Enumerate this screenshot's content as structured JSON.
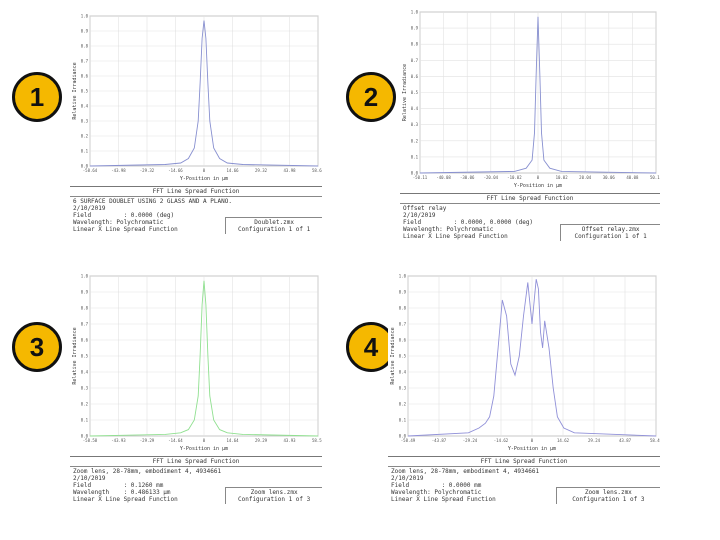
{
  "badges": [
    "1",
    "2",
    "3",
    "4"
  ],
  "chart_data": [
    {
      "type": "line",
      "title": "FFT Line Spread Function",
      "xlabel": "Y-Position in μm",
      "ylabel": "Relative Irradiance",
      "y_ticks": [
        "1.0",
        "0.9",
        "0.8",
        "0.7",
        "0.6",
        "0.5",
        "0.4",
        "0.3",
        "0.2",
        "0.1",
        "0.0"
      ],
      "x_ticks": [
        "-58.64",
        "-43.98",
        "-29.32",
        "-14.66",
        "0",
        "14.66",
        "29.32",
        "43.98",
        "58.64"
      ],
      "ylim": [
        0,
        1
      ],
      "series": [
        {
          "color": "#8890d0",
          "x": [
            -58.64,
            -20,
            -12,
            -8,
            -5,
            -3,
            -2,
            -1,
            0,
            1,
            2,
            3,
            5,
            8,
            12,
            20,
            58.64
          ],
          "y": [
            0,
            0.01,
            0.02,
            0.05,
            0.12,
            0.3,
            0.55,
            0.85,
            0.97,
            0.85,
            0.55,
            0.3,
            0.12,
            0.05,
            0.02,
            0.01,
            0
          ]
        }
      ],
      "footer": {
        "title": "FFT Line Spread Function",
        "lines": [
          "6 SURFACE DOUBLET USING 2 GLASS AND A PLANO.",
          "2/10/2019",
          "Field         : 0.0000 (deg)",
          "Wavelength: Polychromatic",
          "Linear X Line Spread Function"
        ],
        "file": [
          "Doublet.zmx",
          "Configuration 1 of 1"
        ]
      }
    },
    {
      "type": "line",
      "title": "FFT Line Spread Function",
      "xlabel": "Y-Position in μm",
      "ylabel": "Relative Irradiance",
      "y_ticks": [
        "1.0",
        "0.9",
        "0.8",
        "0.7",
        "0.6",
        "0.5",
        "0.4",
        "0.3",
        "0.2",
        "0.1",
        "0.0"
      ],
      "x_ticks": [
        "-50.11",
        "-40.08",
        "-30.06",
        "-20.04",
        "-10.02",
        "0",
        "10.02",
        "20.04",
        "30.06",
        "40.08",
        "50.11"
      ],
      "ylim": [
        0,
        1
      ],
      "series": [
        {
          "color": "#8890d0",
          "x": [
            -50.11,
            -10,
            -5,
            -2.5,
            -1.5,
            -0.8,
            0,
            0.8,
            1.5,
            2.5,
            5,
            10,
            50.11
          ],
          "y": [
            0,
            0.01,
            0.03,
            0.08,
            0.25,
            0.6,
            0.97,
            0.6,
            0.25,
            0.08,
            0.03,
            0.01,
            0
          ]
        }
      ],
      "footer": {
        "title": "FFT Line Spread Function",
        "lines": [
          "Offset relay",
          "2/10/2019",
          "Field         : 0.0000, 0.0000 (deg)",
          "Wavelength: Polychromatic",
          "Linear X Line Spread Function"
        ],
        "file": [
          "Offset relay.zmx",
          "Configuration 1 of 1"
        ]
      }
    },
    {
      "type": "line",
      "title": "FFT Line Spread Function",
      "xlabel": "Y-Position in μm",
      "ylabel": "Relative Irradiance",
      "y_ticks": [
        "1.0",
        "0.9",
        "0.8",
        "0.7",
        "0.6",
        "0.5",
        "0.4",
        "0.3",
        "0.2",
        "0.1",
        "0.0"
      ],
      "x_ticks": [
        "-58.58",
        "-43.93",
        "-29.29",
        "-14.64",
        "0",
        "14.64",
        "29.29",
        "43.93",
        "58.58"
      ],
      "ylim": [
        0,
        1
      ],
      "series": [
        {
          "color": "#90e090",
          "x": [
            -58.58,
            -20,
            -12,
            -8,
            -5,
            -3,
            -2,
            -1,
            0,
            1,
            2,
            3,
            5,
            8,
            12,
            20,
            58.58
          ],
          "y": [
            0,
            0.01,
            0.02,
            0.04,
            0.1,
            0.25,
            0.5,
            0.82,
            0.97,
            0.82,
            0.5,
            0.25,
            0.1,
            0.04,
            0.02,
            0.01,
            0
          ]
        }
      ],
      "footer": {
        "title": "FFT Line Spread Function",
        "lines": [
          "Zoom lens, 28-78mm, embodiment 4, 4934661",
          "2/10/2019",
          "Field         : 0.1260 mm",
          "Wavelength    : 0.486133 μm",
          "Linear X Line Spread Function"
        ],
        "file": [
          "Zoom lens.zmx",
          "Configuration 1 of 3"
        ]
      }
    },
    {
      "type": "line",
      "title": "FFT Line Spread Function",
      "xlabel": "Y-Position in μm",
      "ylabel": "Relative Irradiance",
      "y_ticks": [
        "1.0",
        "0.9",
        "0.8",
        "0.7",
        "0.6",
        "0.5",
        "0.4",
        "0.3",
        "0.2",
        "0.1",
        "0.0"
      ],
      "x_ticks": [
        "-58.49",
        "-43.87",
        "-29.24",
        "-14.62",
        "0",
        "14.62",
        "29.24",
        "43.87",
        "58.49"
      ],
      "ylim": [
        0,
        1
      ],
      "series": [
        {
          "color": "#9090d8",
          "x": [
            -58.49,
            -30,
            -25,
            -22,
            -20,
            -18,
            -16,
            -14,
            -12,
            -10,
            -8,
            -6,
            -4,
            -2,
            0,
            2,
            3,
            4,
            5,
            6,
            8,
            10,
            12,
            15,
            20,
            58.49
          ],
          "y": [
            0,
            0.02,
            0.05,
            0.08,
            0.12,
            0.25,
            0.55,
            0.85,
            0.75,
            0.45,
            0.38,
            0.5,
            0.75,
            0.96,
            0.7,
            0.98,
            0.92,
            0.65,
            0.55,
            0.72,
            0.55,
            0.3,
            0.12,
            0.05,
            0.02,
            0
          ]
        }
      ],
      "footer": {
        "title": "FFT Line Spread Function",
        "lines": [
          "Zoom lens, 28-78mm, embodiment 4, 4934661",
          "2/10/2019",
          "Field         : 0.0000 mm",
          "Wavelength: Polychromatic",
          "Linear X Line Spread Function"
        ],
        "file": [
          "Zoom lens.zmx",
          "Configuration 1 of 3"
        ]
      }
    }
  ]
}
